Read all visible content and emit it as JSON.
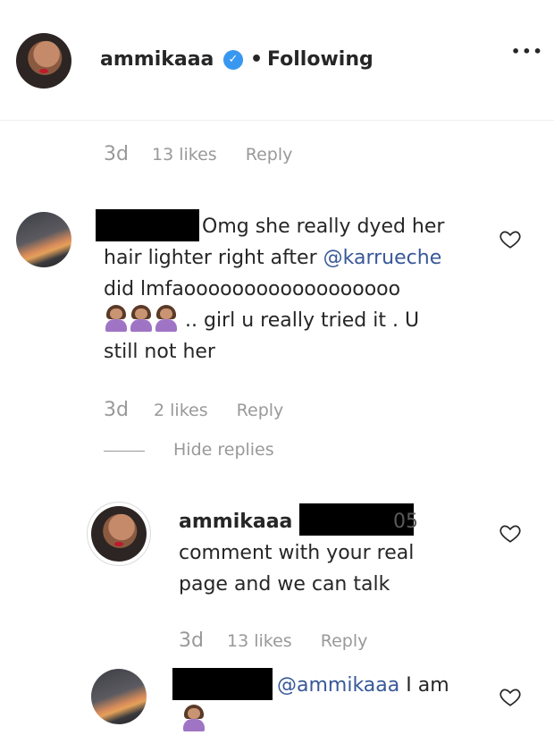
{
  "header": {
    "username": "ammikaaa",
    "separator": "•",
    "following_label": "Following",
    "more_label": "•••"
  },
  "top_meta": {
    "time": "3d",
    "likes": "13 likes",
    "reply": "Reply"
  },
  "comment1": {
    "text_line1": "Omg she really dyed her",
    "text_line2a": "hair lighter right after ",
    "mention": "@karrueche",
    "text_line3": "did lmfaoooooooooooooooooo",
    "text_line4": " .. girl u really tried it . U",
    "text_line5": "still not her",
    "meta": {
      "time": "3d",
      "likes": "2 likes",
      "reply": "Reply"
    },
    "hide_replies": "Hide replies"
  },
  "reply1": {
    "username": "ammikaaa",
    "mention_fragment": "@",
    "mention_fragment_end": "05",
    "text_line2": "comment with your real",
    "text_line3": "page and we can talk",
    "meta": {
      "time": "3d",
      "likes": "13 likes",
      "reply": "Reply"
    }
  },
  "reply2": {
    "mention": "@ammikaaa",
    "text": " I am"
  },
  "colors": {
    "link": "#385898",
    "verified": "#3897f0",
    "meta": "#999999"
  },
  "icons": [
    "verified-badge-icon",
    "heart-icon",
    "more-options-icon",
    "facepalm-emoji-icon",
    "shrug-emoji-icon"
  ]
}
